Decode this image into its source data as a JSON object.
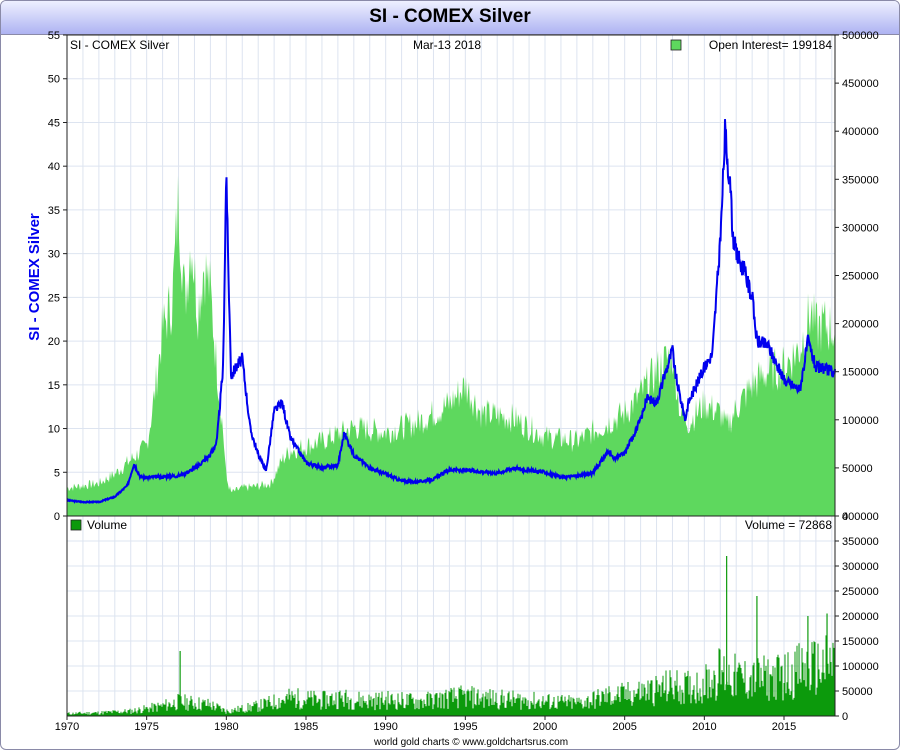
{
  "header": {
    "title": "SI  -  COMEX Silver"
  },
  "colors": {
    "price_line": "#0000ee",
    "open_interest_fill": "#5ed85e",
    "volume_bars": "#0c9a0c",
    "title_bar": "#aeb3f2",
    "grid": "#dde4f0"
  },
  "footer": {
    "credit": "world gold charts © www.goldchartsrus.com"
  },
  "chart_data": [
    {
      "type": "line",
      "panel": "price",
      "header_left": "SI  -  COMEX Silver",
      "header_date": "Mar-13  2018",
      "ylabel": "SI  -  COMEX Silver",
      "ylim": [
        0,
        55
      ],
      "y_ticks": [
        "0",
        "5",
        "10",
        "15",
        "20",
        "25",
        "30",
        "35",
        "40",
        "45",
        "50",
        "55"
      ],
      "right_ylim": [
        0,
        500000
      ],
      "right_ticks": [
        "0",
        "50000",
        "100000",
        "150000",
        "200000",
        "250000",
        "300000",
        "350000",
        "400000",
        "450000",
        "500000"
      ],
      "x_ticks": [
        "1970",
        "1975",
        "1980",
        "1985",
        "1990",
        "1995",
        "2000",
        "2005",
        "2010",
        "2015"
      ],
      "xlim": [
        1970,
        2018.2
      ],
      "legend": "Open Interest= 199184",
      "grid": true,
      "series": [
        {
          "name": "SI  -  COMEX Silver",
          "axis": "left",
          "x": [
            1970,
            1971,
            1972,
            1973,
            1973.8,
            1974.2,
            1974.6,
            1975,
            1976,
            1977,
            1978,
            1979,
            1979.4,
            1979.8,
            1980,
            1980.1,
            1980.3,
            1980.6,
            1981,
            1981.5,
            1982,
            1982.5,
            1983,
            1983.5,
            1984,
            1985,
            1986,
            1987,
            1987.4,
            1988,
            1989,
            1990,
            1991,
            1992,
            1993,
            1994,
            1995,
            1996,
            1997,
            1998,
            1999,
            2000,
            2001,
            2002,
            2003,
            2004,
            2004.3,
            2005,
            2006,
            2006.4,
            2007,
            2008,
            2008.2,
            2008.8,
            2009,
            2010,
            2010.5,
            2010.9,
            2011,
            2011.3,
            2011.6,
            2011.8,
            2012,
            2012.5,
            2013,
            2013.3,
            2014,
            2015,
            2016,
            2016.5,
            2017,
            2018.2
          ],
          "y": [
            1.8,
            1.6,
            1.6,
            2.2,
            3.5,
            6.0,
            4.5,
            4.4,
            4.5,
            4.6,
            5.4,
            7.0,
            8.5,
            17.0,
            40.0,
            30.0,
            16.0,
            17.0,
            18.0,
            10.0,
            7.0,
            5.2,
            12.0,
            13.0,
            9.0,
            6.1,
            5.5,
            5.8,
            9.5,
            7.0,
            5.5,
            4.8,
            4.0,
            3.9,
            4.2,
            5.3,
            5.2,
            5.1,
            4.9,
            5.5,
            5.2,
            5.0,
            4.4,
            4.6,
            4.9,
            7.5,
            6.5,
            7.2,
            11.0,
            13.5,
            13.0,
            19.0,
            16.0,
            11.0,
            13.0,
            17.0,
            18.5,
            29.0,
            31.0,
            44.0,
            38.0,
            32.0,
            30.0,
            28.0,
            25.0,
            20.0,
            19.5,
            15.5,
            14.5,
            20.0,
            17.0,
            16.5
          ]
        },
        {
          "name": "Open Interest",
          "axis": "right",
          "type": "area",
          "x": [
            1970,
            1972,
            1973,
            1974,
            1975,
            1975.5,
            1976,
            1976.6,
            1977,
            1977.4,
            1977.8,
            1978.2,
            1978.6,
            1979,
            1979.4,
            1979.8,
            1980,
            1980.3,
            1981,
            1982,
            1982.8,
            1983.5,
            1984,
            1986,
            1988,
            1990,
            1992,
            1994,
            1995,
            1996,
            1998,
            2000,
            2002,
            2004,
            2005,
            2006,
            2007,
            2008,
            2008.5,
            2009,
            2010,
            2011,
            2011.4,
            2012,
            2013,
            2014,
            2015,
            2016,
            2016.7,
            2017,
            2017.5,
            2018.2
          ],
          "y": [
            30000,
            35000,
            45000,
            60000,
            75000,
            130000,
            200000,
            230000,
            340000,
            230000,
            300000,
            220000,
            270000,
            240000,
            160000,
            90000,
            40000,
            25000,
            30000,
            32000,
            35000,
            60000,
            70000,
            80000,
            95000,
            90000,
            100000,
            120000,
            140000,
            110000,
            105000,
            85000,
            80000,
            100000,
            110000,
            130000,
            155000,
            175000,
            110000,
            100000,
            120000,
            110000,
            95000,
            115000,
            140000,
            155000,
            160000,
            180000,
            220000,
            200000,
            205000,
            199184
          ]
        }
      ]
    },
    {
      "type": "bar",
      "panel": "volume",
      "legend": "Volume",
      "label_last": "Volume = 72868",
      "ylim": [
        0,
        400000
      ],
      "right_ticks": [
        "0",
        "50000",
        "100000",
        "150000",
        "200000",
        "250000",
        "300000",
        "350000",
        "400000"
      ],
      "xlim": [
        1970,
        2018.2
      ],
      "grid": true,
      "series": [
        {
          "name": "Volume",
          "x": [
            1970,
            1972,
            1974,
            1975,
            1976,
            1977,
            1978,
            1979,
            1980,
            1981,
            1982,
            1983,
            1984,
            1985,
            1986,
            1987,
            1988,
            1989,
            1990,
            1991,
            1992,
            1993,
            1994,
            1995,
            1996,
            1997,
            1998,
            1999,
            2000,
            2001,
            2002,
            2003,
            2004,
            2005,
            2006,
            2007,
            2008,
            2009,
            2010,
            2011,
            2012,
            2013,
            2014,
            2015,
            2016,
            2017,
            2018.2
          ],
          "y": [
            6000,
            8000,
            12000,
            18000,
            25000,
            35000,
            32000,
            28000,
            12000,
            18000,
            25000,
            35000,
            45000,
            42000,
            38000,
            45000,
            40000,
            38000,
            40000,
            38000,
            36000,
            40000,
            45000,
            48000,
            45000,
            42000,
            40000,
            38000,
            36000,
            34000,
            32000,
            40000,
            50000,
            52000,
            60000,
            65000,
            75000,
            70000,
            80000,
            110000,
            95000,
            90000,
            95000,
            100000,
            115000,
            120000,
            130000
          ],
          "spikes": [
            [
              1977.1,
              130000
            ],
            [
              2011.4,
              320000
            ],
            [
              2013.3,
              240000
            ],
            [
              2016.5,
              200000
            ],
            [
              2017.7,
              205000
            ]
          ]
        }
      ]
    }
  ]
}
